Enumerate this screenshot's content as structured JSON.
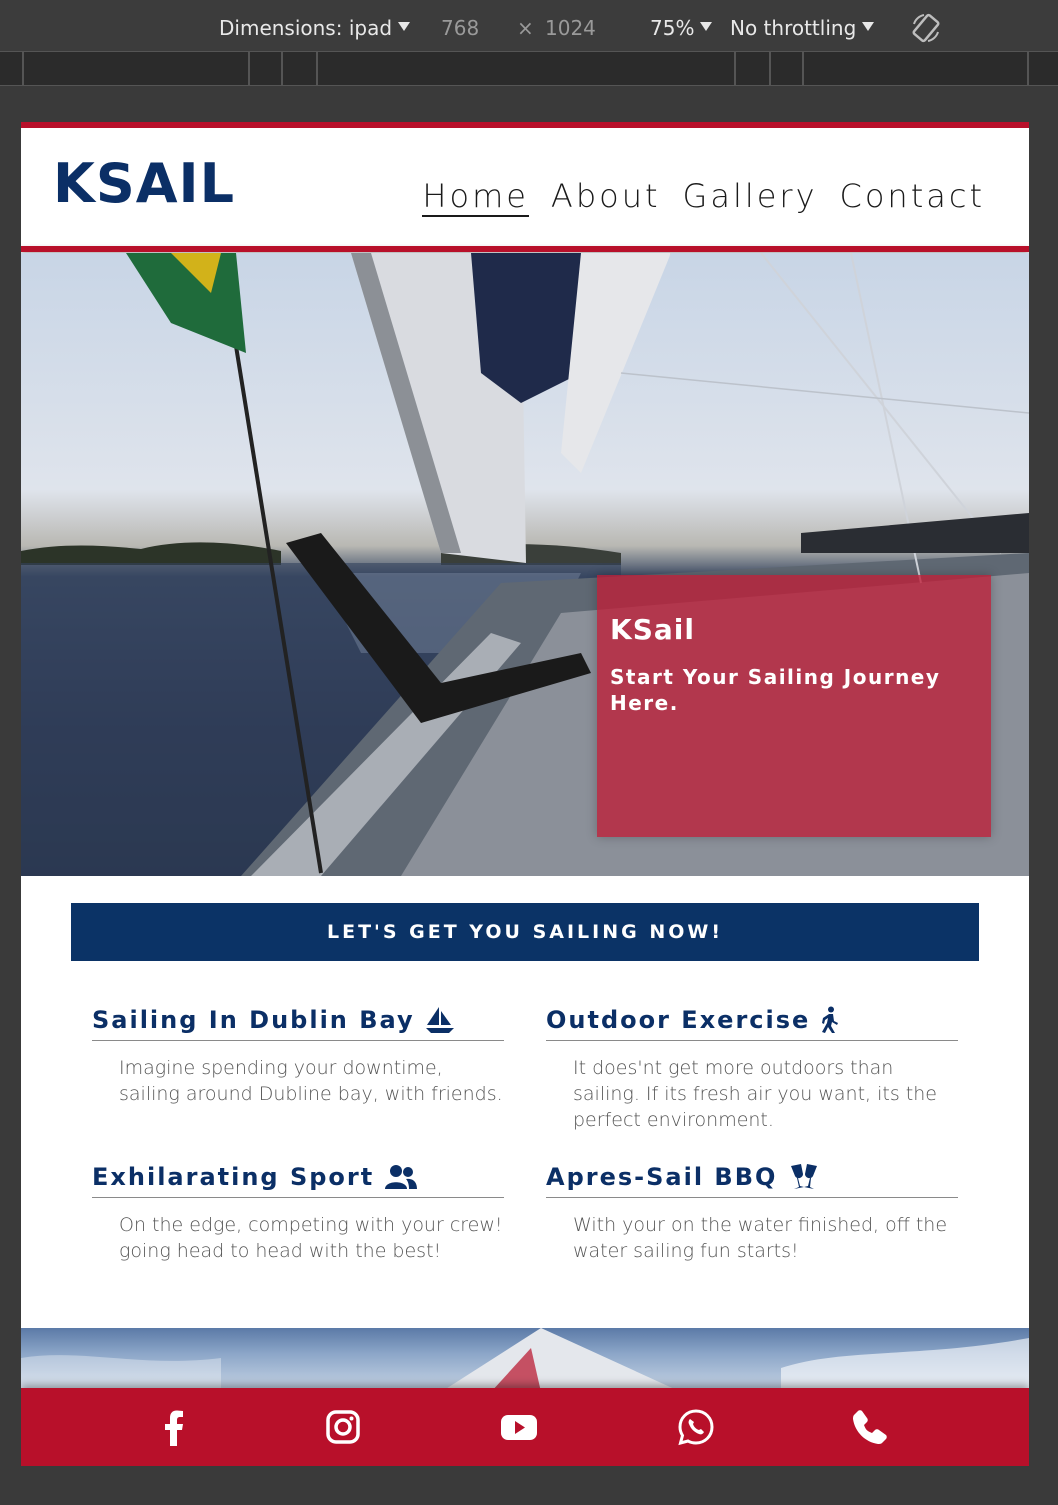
{
  "devtools": {
    "dimensions_label": "Dimensions: ipad",
    "width": "768",
    "times": "×",
    "height": "1024",
    "zoom": "75%",
    "throttling": "No throttling"
  },
  "site": {
    "logo": "KSAIL",
    "nav": [
      "Home",
      "About",
      "Gallery",
      "Contact"
    ],
    "active_nav": "Home"
  },
  "hero": {
    "title": "KSail",
    "subtitle": "Start Your Sailing Journey Here."
  },
  "cta": {
    "label": "LET'S GET YOU SAILING NOW!"
  },
  "features": [
    {
      "title": "Sailing In Dublin Bay",
      "icon": "sailboat-icon",
      "text": "Imagine spending your downtime, sailing around Dubline bay, with friends."
    },
    {
      "title": "Outdoor Exercise",
      "icon": "walking-icon",
      "text": "It does'nt get more outdoors than sailing. If its fresh air you want, its the perfect environment."
    },
    {
      "title": "Exhilarating Sport",
      "icon": "users-icon",
      "text": "On the edge, competing with your crew! going head to head with the best!"
    },
    {
      "title": "Apres-Sail BBQ",
      "icon": "glass-cheers-icon",
      "text": "With your on the water finished, off the water sailing fun starts!"
    }
  ],
  "footer": {
    "icons": [
      "facebook-icon",
      "instagram-icon",
      "youtube-icon",
      "whatsapp-icon",
      "phone-icon"
    ]
  },
  "colors": {
    "brand_red": "#b8102a",
    "brand_navy": "#0b2f66",
    "cta_navy": "#0b3366"
  }
}
